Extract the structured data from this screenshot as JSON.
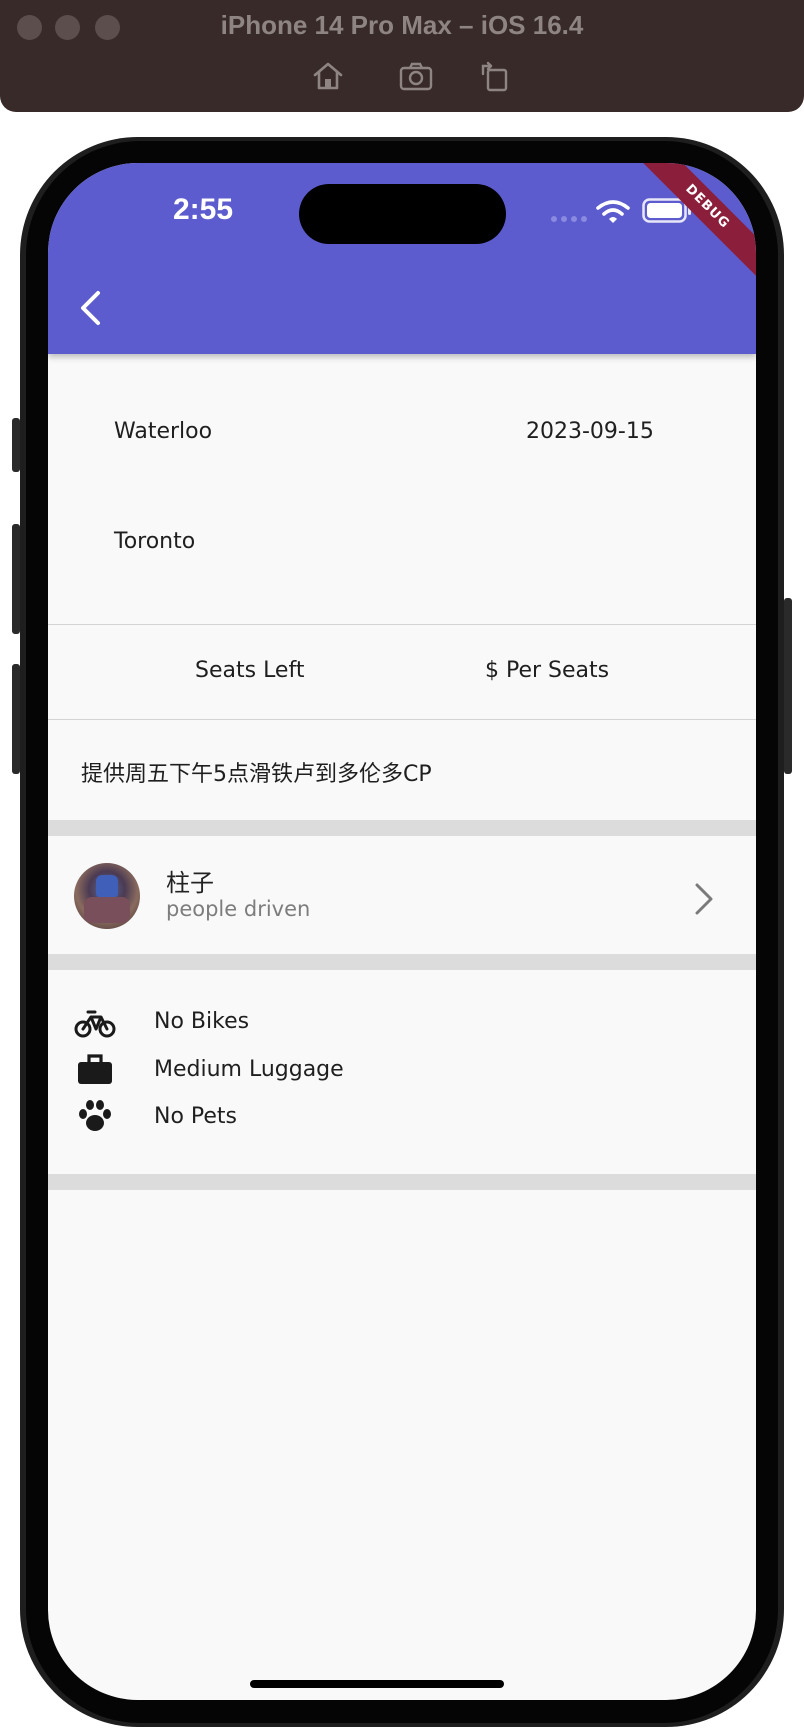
{
  "window": {
    "title": "iPhone 14 Pro Max – iOS 16.4"
  },
  "toolbar": {
    "icons": [
      "home-icon",
      "screenshot-icon",
      "rotate-icon"
    ]
  },
  "status_bar": {
    "time": "2:55"
  },
  "debug_banner": "DEBUG",
  "colors": {
    "appbar": "#5c5ccf",
    "background": "#f9f9f9",
    "band": "#dcdcdc",
    "debug": "#8b1f3b"
  },
  "trip": {
    "from": "Waterloo",
    "date": "2023-09-15",
    "to": "Toronto",
    "seats_left_label": "Seats Left",
    "price_label": "$ Per Seats",
    "description": "提供周五下午5点滑铁卢到多伦多CP"
  },
  "driver": {
    "name": "柱子",
    "subtitle": "people driven"
  },
  "features": [
    {
      "icon": "bike-icon",
      "label": "No Bikes"
    },
    {
      "icon": "luggage-icon",
      "label": "Medium Luggage"
    },
    {
      "icon": "paw-icon",
      "label": "No Pets"
    }
  ]
}
